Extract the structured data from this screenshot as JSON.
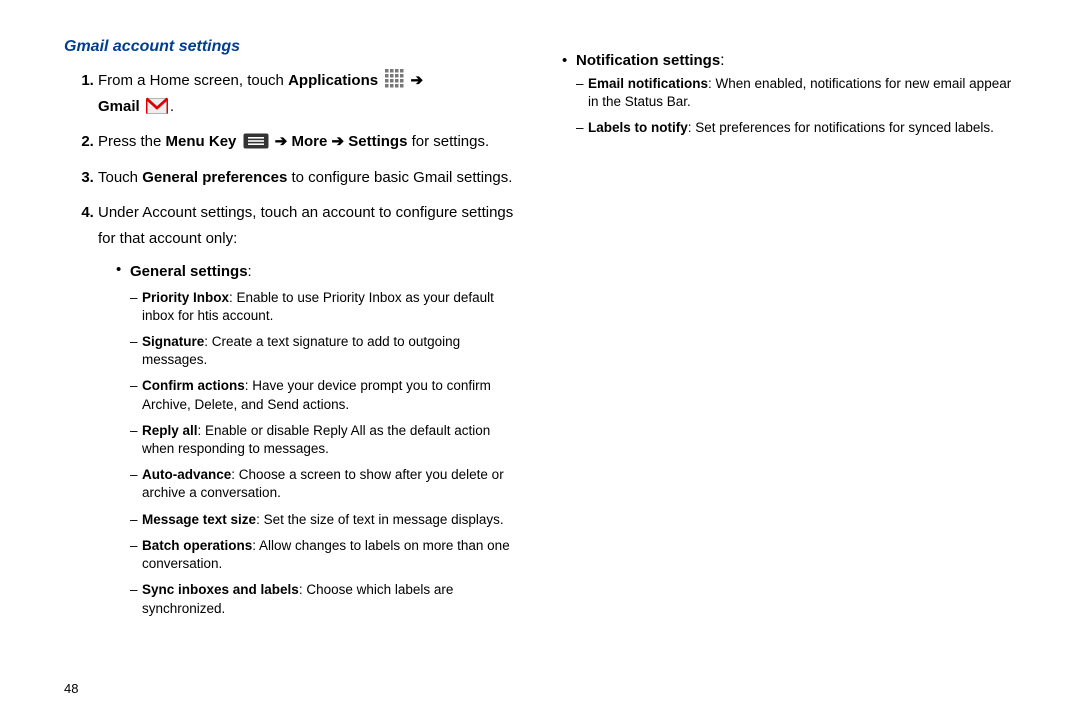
{
  "left": {
    "title": "Gmail account settings",
    "steps": {
      "s1_a": "From a Home screen, touch ",
      "s1_apps": "Applications",
      "s1_arrow1": "➔",
      "s1_gmail": "Gmail",
      "s1_period": ".",
      "s2_a": "Press the ",
      "s2_menu": "Menu Key",
      "s2_arrow1": "➔",
      "s2_more": "More",
      "s2_arrow2": "➔",
      "s2_settings": "Settings",
      "s2_tail": " for settings.",
      "s3_a": "Touch ",
      "s3_b": "General preferences",
      "s3_c": " to configure basic Gmail settings.",
      "s4": "Under Account settings, touch an account to configure settings for that account only:"
    },
    "general_label": "General settings",
    "general_colon": ":",
    "general_items": [
      {
        "b": "Priority Inbox",
        "t": ": Enable to use Priority Inbox as your default inbox for htis account."
      },
      {
        "b": "Signature",
        "t": ": Create a text signature to add to outgoing messages."
      },
      {
        "b": "Confirm  actions",
        "t": ": Have your device prompt you to confirm Archive, Delete, and Send actions."
      },
      {
        "b": "Reply all",
        "t": ": Enable or disable Reply All as the default action when responding to messages."
      },
      {
        "b": "Auto-advance",
        "t": ": Choose a screen to show after you delete or archive a conversation."
      },
      {
        "b": "Message text size",
        "t": ": Set the size of text in message displays."
      },
      {
        "b": "Batch operations",
        "t": ": Allow changes to labels on more than one conversation."
      },
      {
        "b": "Sync inboxes and labels",
        "t": ": Choose which labels are synchronized."
      }
    ]
  },
  "right": {
    "notif_label": "Notification settings",
    "notif_colon": ":",
    "notif_items": [
      {
        "b": "Email notifications",
        "t": ": When enabled, notifications for new email appear in the Status Bar."
      },
      {
        "b": "Labels to notify",
        "t": ": Set preferences for notifications for synced labels."
      }
    ]
  },
  "page_number": "48"
}
